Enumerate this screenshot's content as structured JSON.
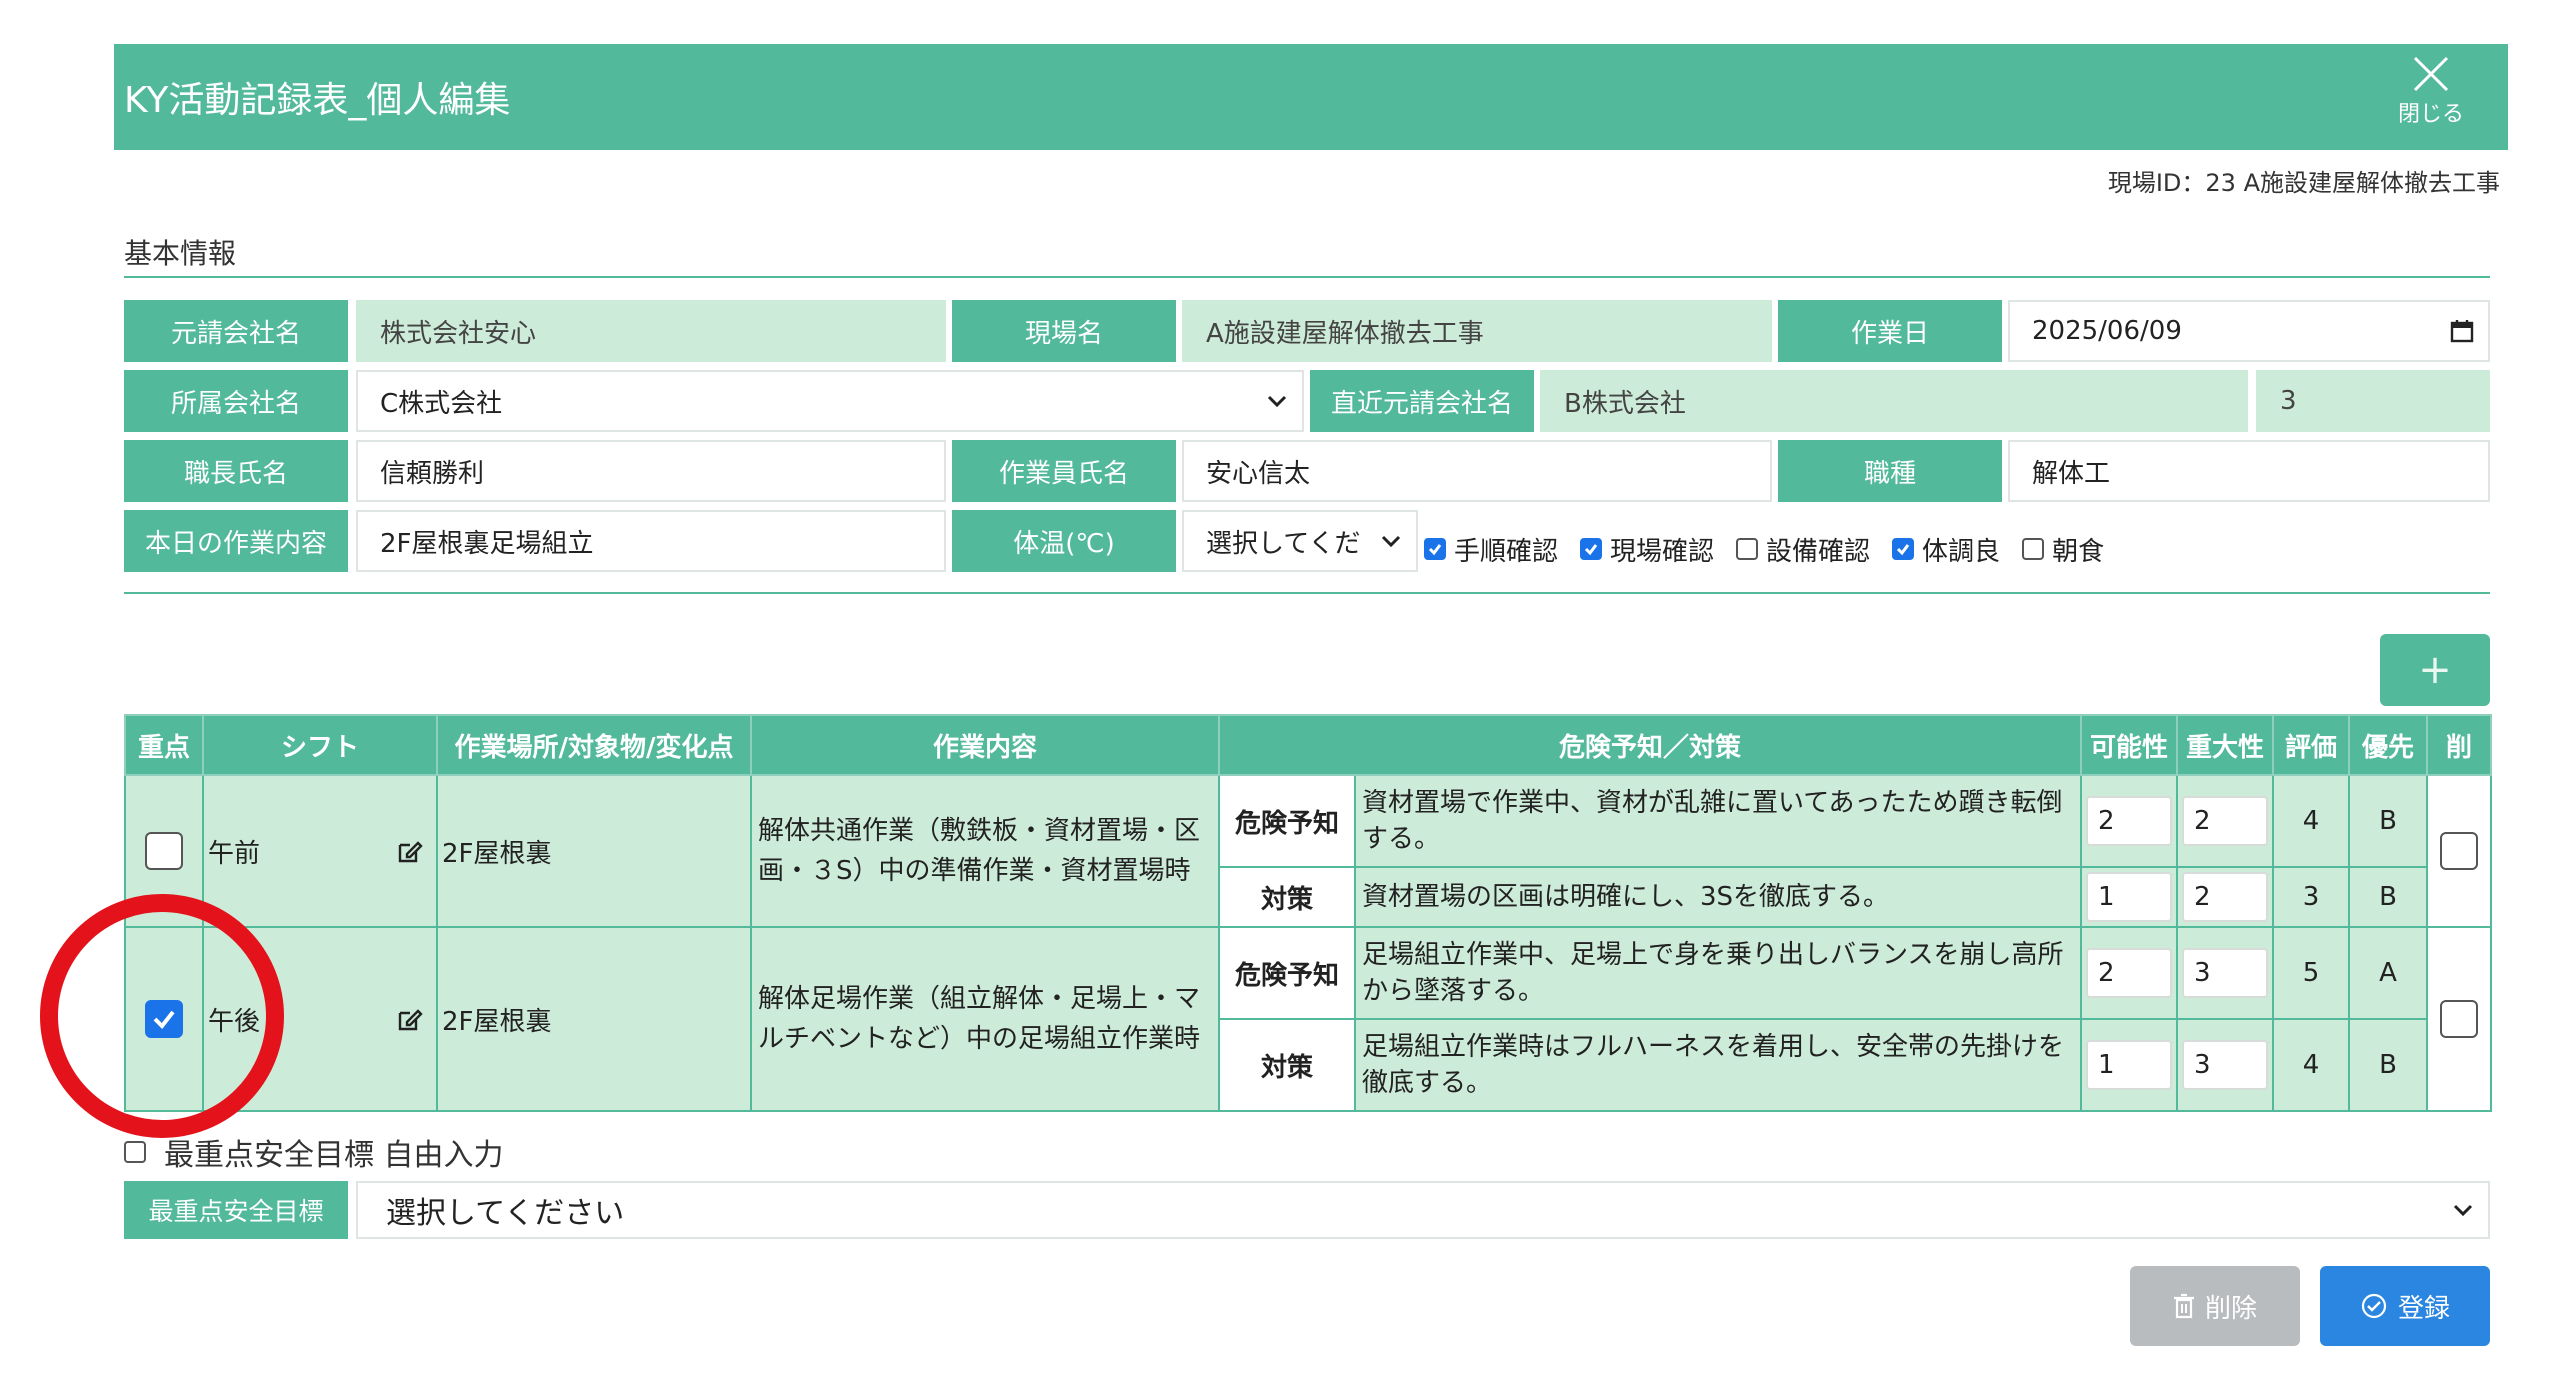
{
  "modal": {
    "title": "KY活動記録表_個人編集",
    "close_label": "閉じる"
  },
  "site_id": "現場ID：23 A施設建屋解体撤去工事",
  "basic_info": {
    "section_title": "基本情報",
    "prime_company_label": "元請会社名",
    "prime_company_value": "株式会社安心",
    "site_name_label": "現場名",
    "site_name_value": "A施設建屋解体撤去工事",
    "work_date_label": "作業日",
    "work_date_value": "2025/06/09",
    "affiliate_label": "所属会社名",
    "affiliate_value": "C株式会社",
    "direct_prime_label": "直近元請会社名",
    "direct_prime_value": "B株式会社",
    "direct_prime_number": "3",
    "foreman_label": "職長氏名",
    "foreman_value": "信頼勝利",
    "worker_label": "作業員氏名",
    "worker_value": "安心信太",
    "occupation_label": "職種",
    "occupation_value": "解体工",
    "today_work_label": "本日の作業内容",
    "today_work_value": "2F屋根裏足場組立",
    "temp_label": "体温(℃)",
    "temp_select": "選択してくだ",
    "checks": [
      {
        "label": "手順確認",
        "checked": true
      },
      {
        "label": "現場確認",
        "checked": true
      },
      {
        "label": "設備確認",
        "checked": false
      },
      {
        "label": "体調良",
        "checked": true
      },
      {
        "label": "朝食",
        "checked": false
      }
    ]
  },
  "add_button": "+",
  "table": {
    "headers": [
      "重点",
      "シフト",
      "作業場所/対象物/変化点",
      "作業内容",
      "危険予知／対策",
      "可能性",
      "重大性",
      "評価",
      "優先",
      "削"
    ],
    "rows": [
      {
        "priority_checked": false,
        "shift": "午前",
        "place": "2F屋根裏",
        "content": "解体共通作業（敷鉄板・資材置場・区画・３S）中の準備作業・資材置場時",
        "danger_label": "危険予知",
        "danger_text": "資材置場で作業中、資材が乱雑に置いてあったため躓き転倒する。",
        "danger_possibility": "2",
        "danger_severity": "2",
        "danger_eval": "4",
        "danger_priority": "B",
        "measure_label": "対策",
        "measure_text": "資材置場の区画は明確にし、3Sを徹底する。",
        "measure_possibility": "1",
        "measure_severity": "2",
        "measure_eval": "3",
        "measure_priority": "B"
      },
      {
        "priority_checked": true,
        "shift": "午後",
        "place": "2F屋根裏",
        "content": "解体足場作業（組立解体・足場上・マルチベントなど）中の足場組立作業時",
        "danger_label": "危険予知",
        "danger_text": "足場組立作業中、足場上で身を乗り出しバランスを崩し高所から墜落する。",
        "danger_possibility": "2",
        "danger_severity": "3",
        "danger_eval": "5",
        "danger_priority": "A",
        "measure_label": "対策",
        "measure_text": "足場組立作業時はフルハーネスを着用し、安全帯の先掛けを徹底する。",
        "measure_possibility": "1",
        "measure_severity": "3",
        "measure_eval": "4",
        "measure_priority": "B"
      }
    ]
  },
  "safety_goal": {
    "free_input_label": "最重点安全目標 自由入力",
    "label": "最重点安全目標",
    "select_value": "選択してください"
  },
  "buttons": {
    "delete": "削除",
    "save": "登録"
  }
}
